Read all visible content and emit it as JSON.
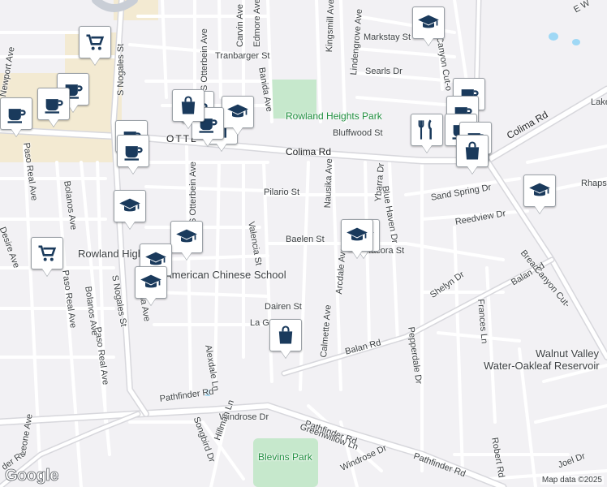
{
  "map": {
    "attribution": "Map data ©2025",
    "logo": "Google",
    "colors": {
      "background": "#f2f1f4",
      "road": "#ffffff",
      "road_casing": "#d7d7dc",
      "highway": "#c9ced6",
      "park": "#c6e8cc",
      "commercial": "#f3ead2",
      "water": "#9fd8f5",
      "pin_icon": "#1a3a5c"
    }
  },
  "labels": {
    "colima_rd_1": "Colima Rd",
    "colima_rd_2": "Colima Rd",
    "ottl": "OTTL",
    "s_nogales_1": "S Nogales St",
    "s_nogales_2": "S Nogales St",
    "s_otterbein_1": "S Otterbein Ave",
    "s_otterbein_2": "S Otterbein Ave",
    "carvin": "Carvin Ave",
    "edmore": "Edmore Ave",
    "tranbarger": "Tranbarger St",
    "banida": "Banida Ave",
    "kingsmill": "Kingsmill Ave",
    "lindengrove": "Lindengrove Ave",
    "markstay": "Markstay St",
    "canyon_cutoff": "Canyon Cut-o",
    "searls": "Searls Dr",
    "bluffwood": "Bluffwood St",
    "newport": "Newport Ave",
    "paso_real_1": "Paso Real Ave",
    "paso_real_2": "Paso Real Ave",
    "paso_real_3": "Paso Real Ave",
    "bolanos_1": "Bolanos Ave",
    "bolanos_2": "Bolanos Ave",
    "desire": "Desire Ave",
    "pilario": "Pilario St",
    "nausika": "Nausika Ave",
    "ybarra": "Ybarra Dr",
    "blue_haven": "Blue Haven Dr",
    "sand_spring": "Sand Spring Dr",
    "rhaps": "Rhaps",
    "reedview": "Reedview Dr",
    "valencia": "Valencia St",
    "baelen": "Baelen St",
    "arcdale": "Arcdale Ave",
    "macora": "Macora St",
    "shelyn": "Shelyn Dr",
    "balan_1": "Balan Rd",
    "balan_2": "Balan Rd",
    "brea_canyon": "Brea Canyon Cut-",
    "frances": "Frances Ln",
    "dairen": "Dairen St",
    "la_ga": "La Ga",
    "calmette": "Calmette Ave",
    "pepperdale": "Pepperdale Dr",
    "alexdale": "Alexdale Ln",
    "leona": "Leona Ave",
    "lake": "Lake",
    "e_w": "E W",
    "pathfinder_1": "Pathfinder Rd",
    "pathfinder_2": "Pathfinder Rd",
    "pathfinder_3": "Pathfinder Rd",
    "pathfinder_4": "Pathfinder Rd",
    "windrose_1": "Windrose Dr",
    "windrose_2": "Windrose Dr",
    "greenwillow": "Greenwillow Ln",
    "songbird": "Songbird Dr",
    "hillman": "Hillman Ln",
    "robert": "Robert Rd",
    "joel": "Joel Dr",
    "leone": "Leone Ave",
    "der_rd": "der Rd",
    "rowland_heights_park": "Rowland Heights Park",
    "american_chinese_school": "American Chinese School",
    "rowland_high": "Rowland High",
    "blevins_park": "Blevins Park",
    "walnut_valley": "Walnut Valley",
    "oakleaf_reservoir": "Water-Oakleaf Reservoir"
  },
  "pins": [
    {
      "icon": "shopping-cart-icon"
    },
    {
      "icon": "coffee-cup-icon"
    },
    {
      "icon": "coffee-cup-icon"
    },
    {
      "icon": "coffee-cup-icon"
    },
    {
      "icon": "graduation-cap-icon"
    },
    {
      "icon": "shopping-bag-icon"
    },
    {
      "icon": "coffee-cup-icon"
    },
    {
      "icon": "coffee-cup-icon"
    },
    {
      "icon": "restaurant-icon"
    },
    {
      "icon": "graduation-cap-icon"
    },
    {
      "icon": "coffee-cup-icon"
    },
    {
      "icon": "coffee-cup-icon"
    },
    {
      "icon": "graduation-cap-icon"
    },
    {
      "icon": "shopping-cart-icon"
    },
    {
      "icon": "graduation-cap-icon"
    },
    {
      "icon": "graduation-cap-icon"
    },
    {
      "icon": "graduation-cap-icon"
    },
    {
      "icon": "graduation-cap-icon"
    },
    {
      "icon": "shopping-bag-icon"
    },
    {
      "icon": "graduation-cap-icon"
    },
    {
      "icon": "shopping-bag-icon"
    },
    {
      "icon": "coffee-cup-icon"
    },
    {
      "icon": "coffee-cup-icon"
    },
    {
      "icon": "restaurant-icon"
    },
    {
      "icon": "coffee-cup-icon"
    },
    {
      "icon": "coffee-cup-icon"
    },
    {
      "icon": "shopping-bag-icon"
    },
    {
      "icon": "graduation-cap-icon"
    }
  ]
}
